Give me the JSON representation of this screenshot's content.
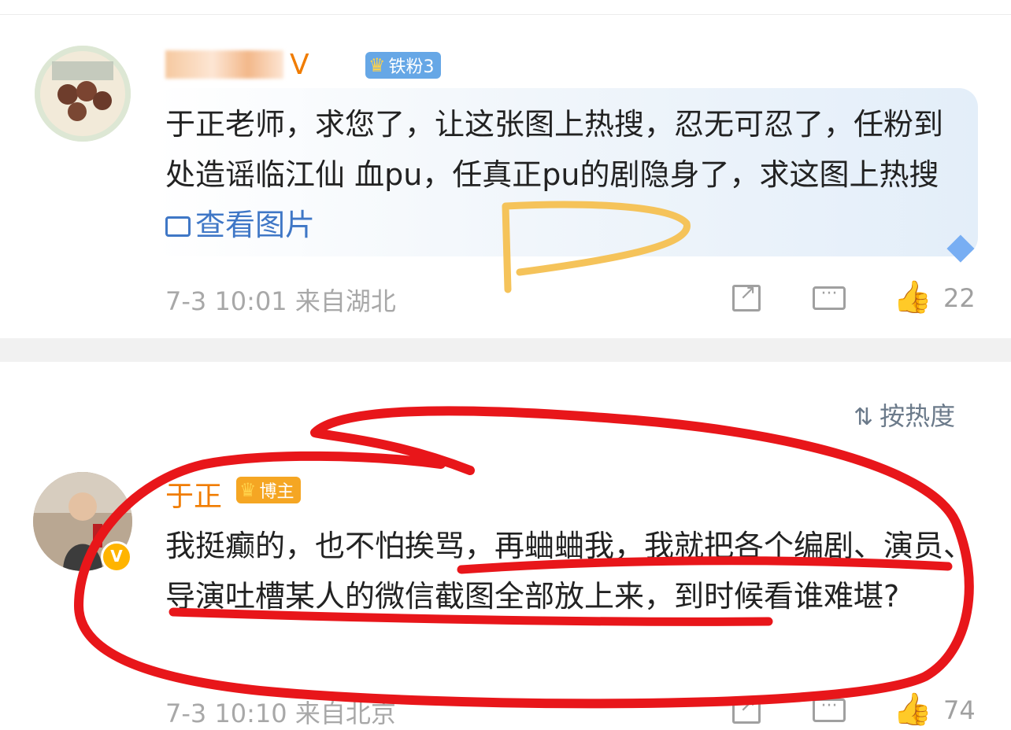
{
  "comment1": {
    "user_suffix": "V",
    "fan_badge": "铁粉3",
    "text": "于正老师，求您了，让这张图上热搜，忍无可忍了，任粉到处造谣临江仙 血pu，任真正pu的剧隐身了，求这图上热搜",
    "view_image": "查看图片",
    "meta": "7-3 10:01 来自湖北",
    "likes": "22",
    "icons": [
      "share-icon",
      "comment-icon",
      "like-icon",
      "image-icon",
      "diamond-icon"
    ]
  },
  "sort": {
    "label": "按热度",
    "icon": "sort-icon"
  },
  "comment2": {
    "username": "于正",
    "role_badge": "博主",
    "verified_mark": "V",
    "text": "我挺癫的，也不怕挨骂，再蛐蛐我，我就把各个编剧、演员、导演吐槽某人的微信截图全部放上来，到时候看谁难堪?",
    "meta": "7-3 10:10 来自北京",
    "likes": "74",
    "icons": [
      "share-icon",
      "comment-icon",
      "like-icon",
      "verified-icon",
      "crown-icon"
    ]
  },
  "colors": {
    "username": "#f07c00",
    "link": "#3f77c6",
    "meta": "#a8a8a8",
    "fan_badge": "#66a7e6",
    "role_badge": "#f5a623",
    "annotation_yellow": "#f5c35a",
    "annotation_red": "#e8161a"
  }
}
